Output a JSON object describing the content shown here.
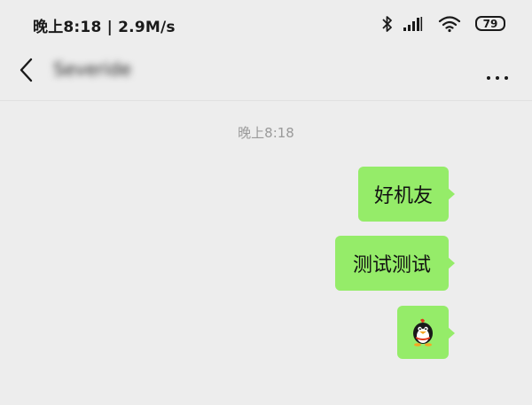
{
  "status_bar": {
    "time_speed": "晚上8:18 | 2.9M/s",
    "battery": "79",
    "icons": [
      "bluetooth-icon",
      "signal-icon",
      "wifi-icon",
      "battery-icon"
    ]
  },
  "header": {
    "title": "Severide",
    "back_icon": "chevron-left-icon",
    "more_icon": "more-icon"
  },
  "chat": {
    "timestamp": "晚上8:18",
    "messages": [
      {
        "text": "好机友"
      },
      {
        "text": "测试测试"
      },
      {
        "sticker": "penguin-sticker"
      }
    ]
  },
  "colors": {
    "background": "#ededed",
    "bubble": "#95ec69",
    "timestamp": "#9a9a9a"
  }
}
